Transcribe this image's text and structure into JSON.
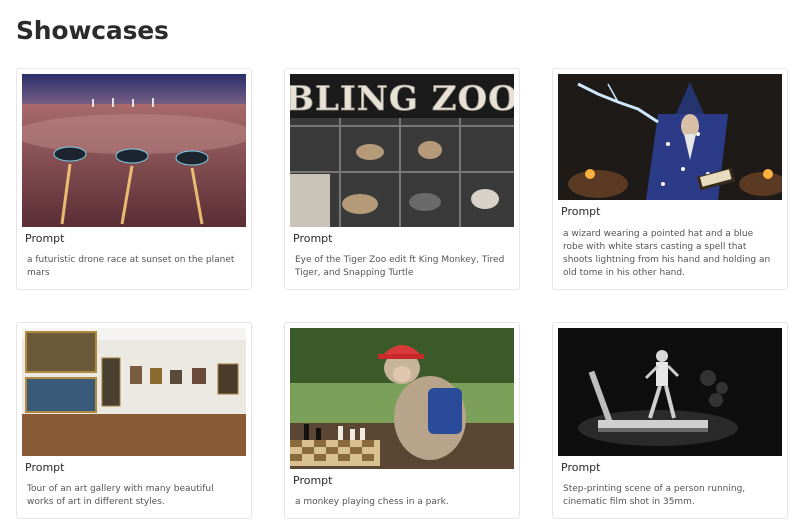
{
  "page": {
    "title": "Showcases"
  },
  "showcases": [
    {
      "label": "Prompt",
      "text": "a futuristic drone race at sunset on the planet mars",
      "image": "drone-race-image"
    },
    {
      "label": "Prompt",
      "text": "Eye of the Tiger Zoo edit ft King Monkey, Tired Tiger, and Snapping Turtle",
      "image": "bling-zoo-image",
      "sign_text": "BLING ZOO"
    },
    {
      "label": "Prompt",
      "text": "a wizard wearing a pointed hat and a blue robe with white stars casting a spell that shoots lightning from his hand and holding an old tome in his other hand.",
      "image": "wizard-image"
    },
    {
      "label": "Prompt",
      "text": "Tour of an art gallery with many beautiful works of art in different styles.",
      "image": "art-gallery-image"
    },
    {
      "label": "Prompt",
      "text": "a monkey playing chess in a park.",
      "image": "monkey-chess-image"
    },
    {
      "label": "Prompt",
      "text": "Step-printing scene of a person running, cinematic film shot in 35mm.",
      "image": "treadmill-runner-image"
    }
  ]
}
